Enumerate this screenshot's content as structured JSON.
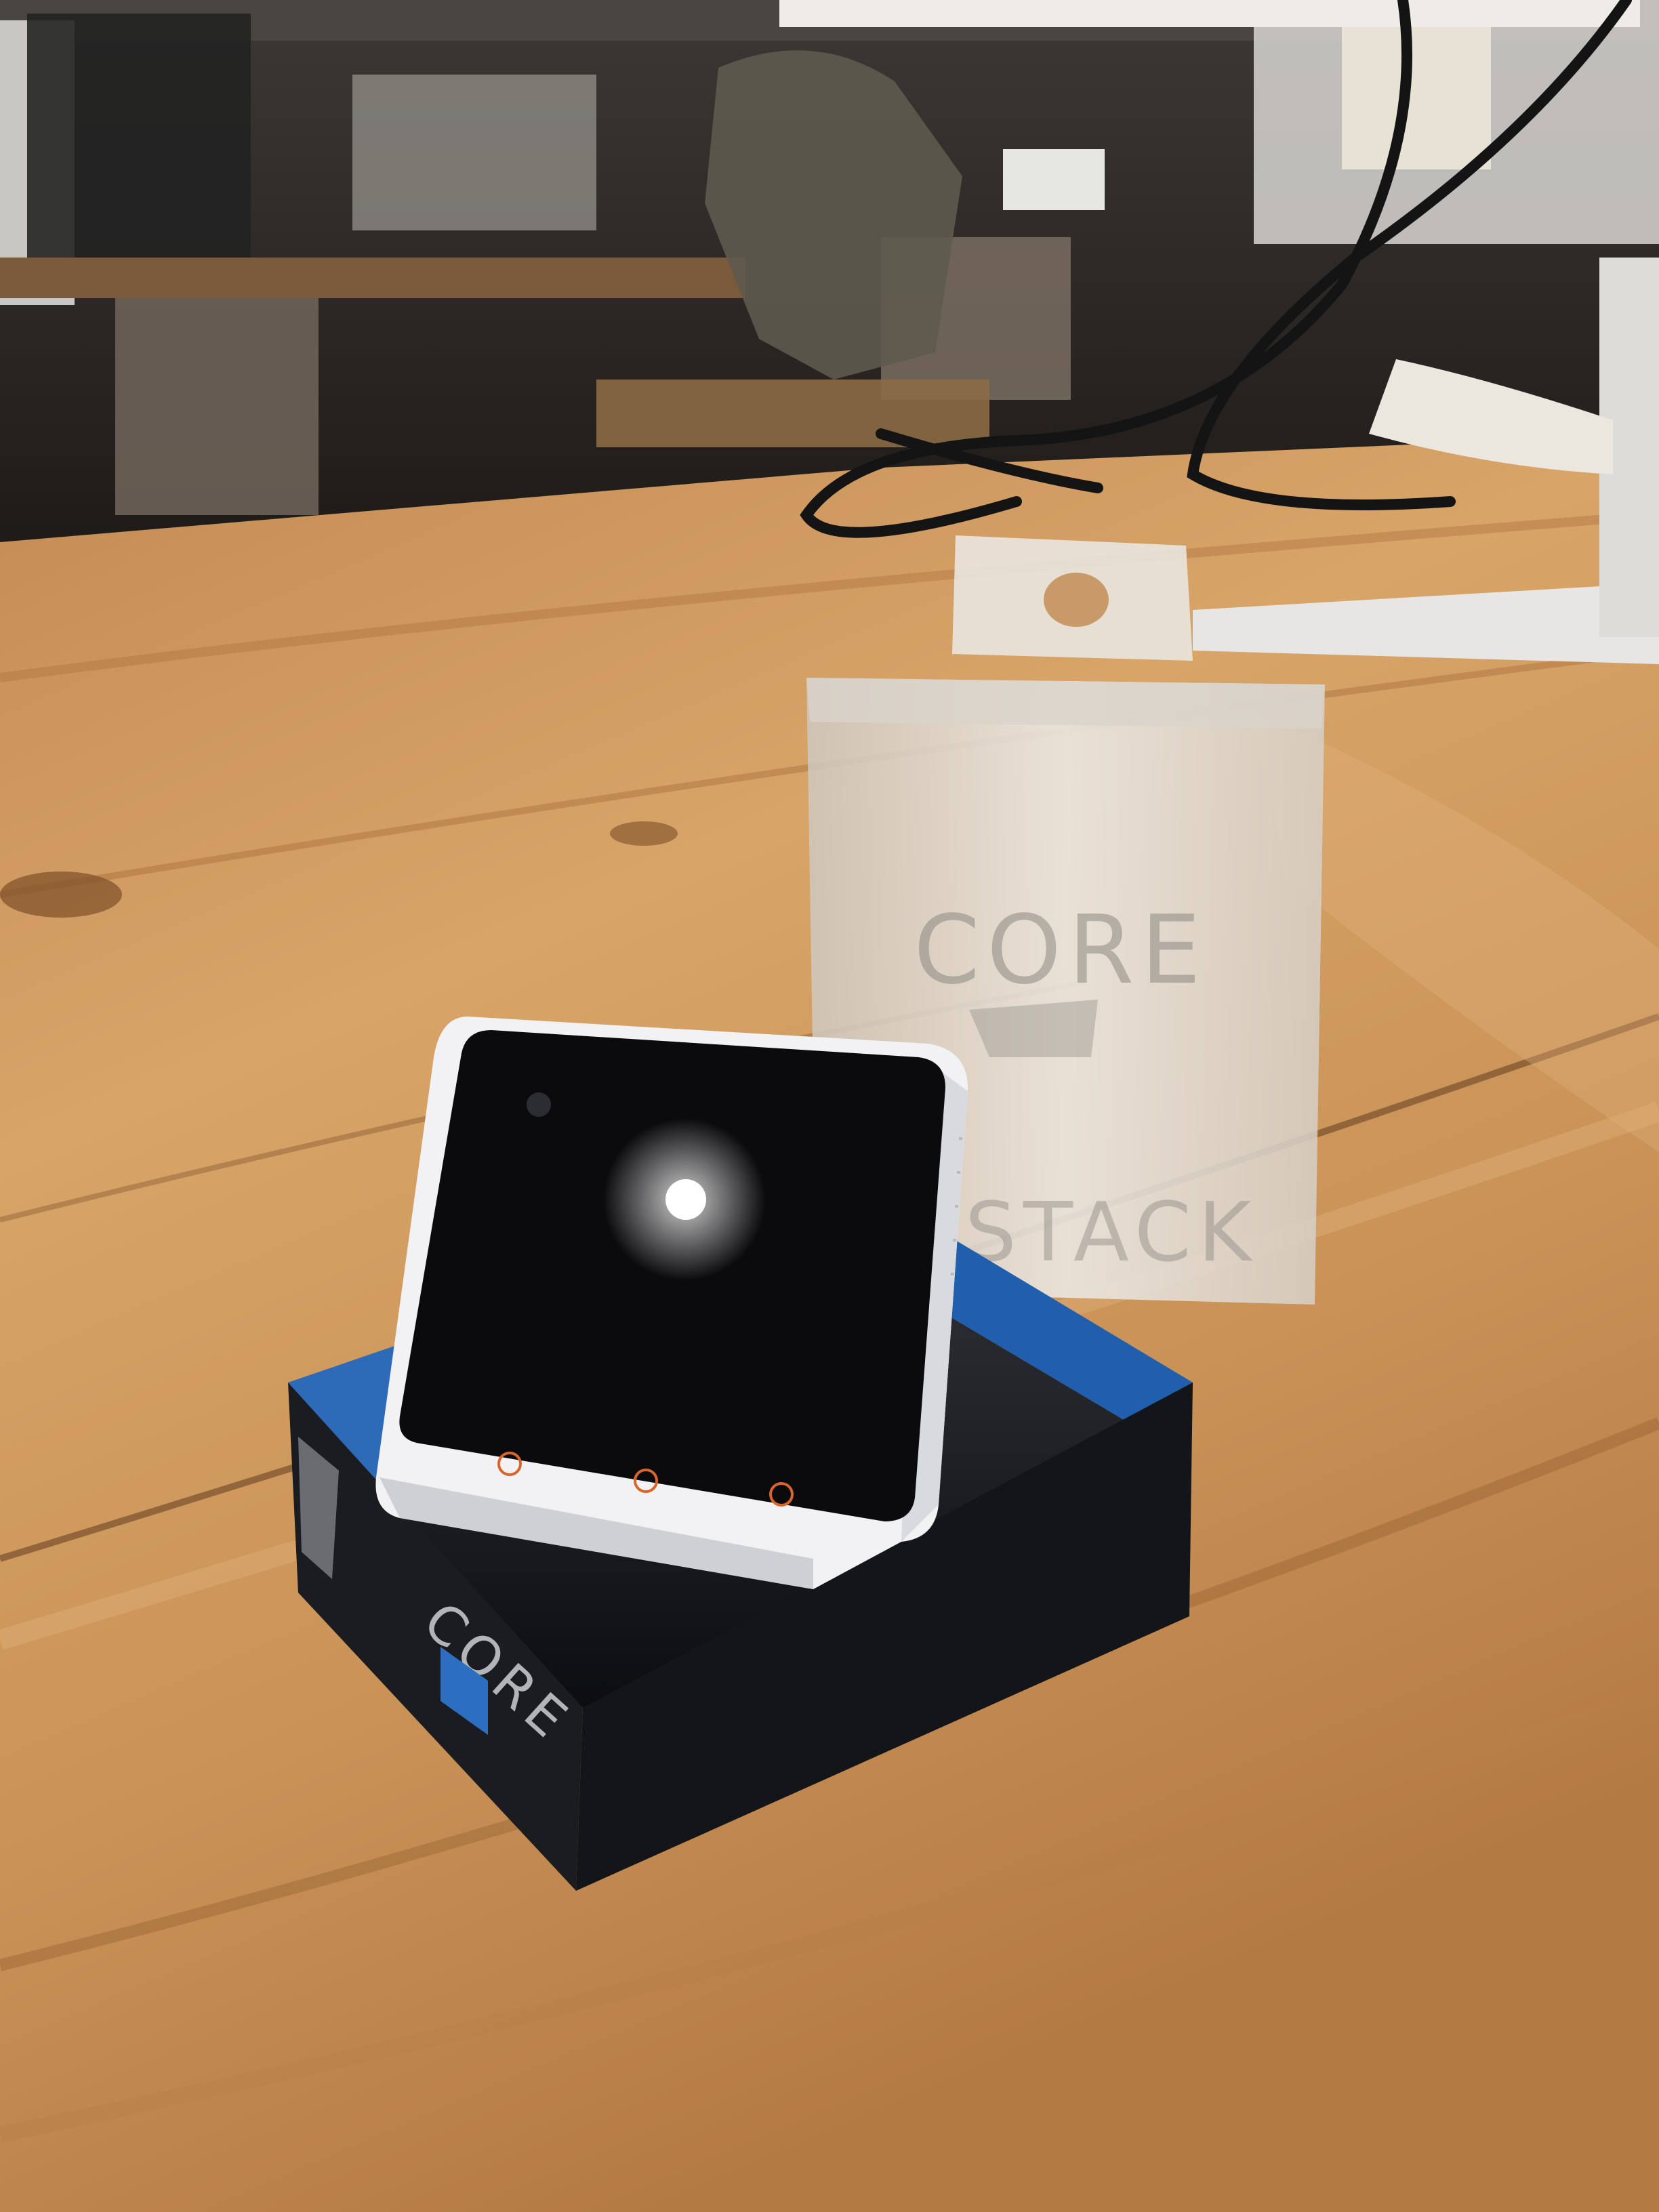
{
  "photo": {
    "sleeve_print": {
      "line1": "CORE",
      "line2": "STACK"
    },
    "box_print": "CORE",
    "colors": {
      "wood_light": "#d9a466",
      "wood_mid": "#c48a4f",
      "wood_dark": "#8f5a2f",
      "room_dark": "#2b2622",
      "screen_black": "#0b0b0e",
      "device_white": "#f2f2f4",
      "box_black": "#151619",
      "box_blue": "#1f5fae",
      "sleeve_frost": "#e6e2dc",
      "button_orange": "#d8662c",
      "cable_black": "#141414"
    },
    "screen_buttons": 3
  }
}
